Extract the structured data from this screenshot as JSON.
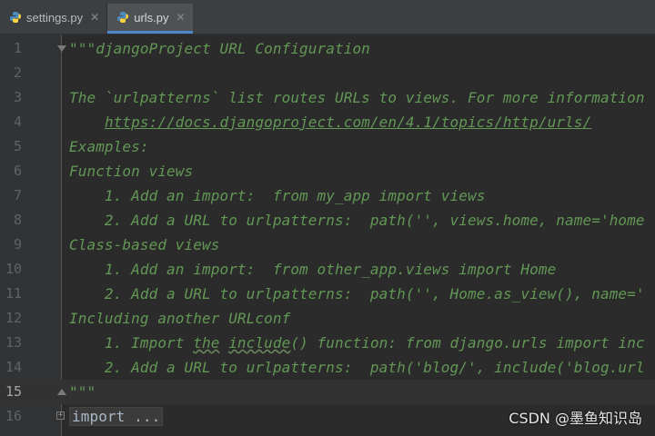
{
  "tabs": [
    {
      "label": "settings.py",
      "icon": "python-file-icon",
      "active": false
    },
    {
      "label": "urls.py",
      "icon": "python-file-icon",
      "active": true
    }
  ],
  "tab_close_glyph": "✕",
  "editor": {
    "current_line": 15,
    "lines": [
      {
        "n": "1",
        "text": "\"\"\"djangoProject URL Configuration"
      },
      {
        "n": "2",
        "text": ""
      },
      {
        "n": "3",
        "text": "The `urlpatterns` list routes URLs to views. For more information"
      },
      {
        "n": "4",
        "prefix": "    ",
        "url": "https://docs.djangoproject.com/en/4.1/topics/http/urls/"
      },
      {
        "n": "5",
        "text": "Examples:"
      },
      {
        "n": "6",
        "text": "Function views"
      },
      {
        "n": "7",
        "text": "    1. Add an import:  from my_app import views"
      },
      {
        "n": "8",
        "text": "    2. Add a URL to urlpatterns:  path('', views.home, name='home"
      },
      {
        "n": "9",
        "text": "Class-based views"
      },
      {
        "n": "10",
        "text": "    1. Add an import:  from other_app.views import Home"
      },
      {
        "n": "11",
        "text": "    2. Add a URL to urlpatterns:  path('', Home.as_view(), name='"
      },
      {
        "n": "12",
        "text": "Including another URLconf"
      },
      {
        "n": "13",
        "p1": "    1. Import ",
        "t1": "the",
        "p2": " ",
        "t2": "include",
        "p3": "() function: from django.urls import inc"
      },
      {
        "n": "14",
        "text": "    2. Add a URL to urlpatterns:  path('blog/', include('blog.url"
      },
      {
        "n": "15",
        "text": "\"\"\""
      },
      {
        "n": "16",
        "folded": "import ..."
      }
    ]
  },
  "watermark": "CSDN @墨鱼知识岛",
  "colors": {
    "background": "#2b2b2b",
    "docstring": "#629755",
    "line_number": "#606366",
    "accent_tab_underline": "#4a88c7"
  }
}
